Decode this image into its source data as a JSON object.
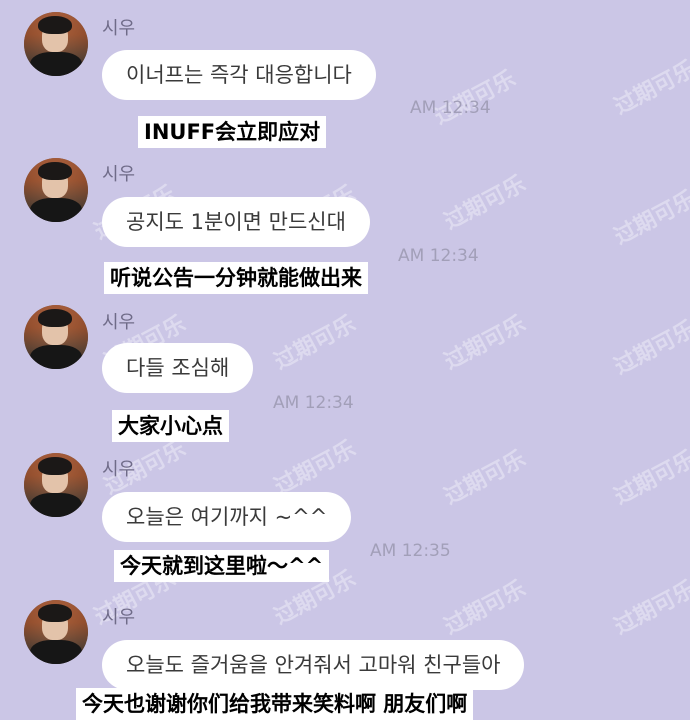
{
  "watermark_text": "过期可乐",
  "messages": [
    {
      "sender": "시우",
      "text": "이너프는 즉각 대응합니다",
      "time": "AM 12:34",
      "subtitle": "INUFF会立即应对"
    },
    {
      "sender": "시우",
      "text": "공지도 1분이면 만드신대",
      "time": "AM 12:34",
      "subtitle": "听说公告一分钟就能做出来"
    },
    {
      "sender": "시우",
      "text": "다들 조심해",
      "time": "AM 12:34",
      "subtitle": "大家小心点"
    },
    {
      "sender": "시우",
      "text": "오늘은 여기까지 ~^^",
      "time": "AM 12:35",
      "subtitle": "今天就到这里啦～^^"
    },
    {
      "sender": "시우",
      "text": "오늘도 즐거움을 안겨줘서 고마워 친구들아",
      "time": "",
      "subtitle": "今天也谢谢你们给我带来笑料啊 朋友们啊"
    }
  ]
}
